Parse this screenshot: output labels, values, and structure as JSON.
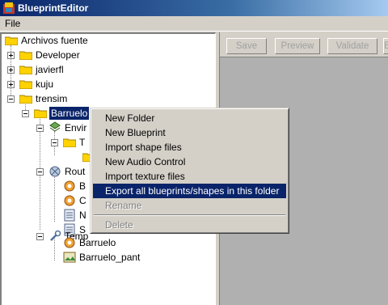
{
  "window": {
    "title": "BlueprintEditor"
  },
  "menu": {
    "file": "File"
  },
  "toolbar": {
    "save": "Save",
    "preview": "Preview",
    "validate": "Validate",
    "extra": "E"
  },
  "tree": {
    "root": "Archivos fuente",
    "developer": "Developer",
    "javierfl": "javierfl",
    "kuju": "kuju",
    "trensim": "trensim",
    "barruelo": "Barruelo",
    "envir": "Envir",
    "t_folder": "T",
    "routes": "Rout",
    "r1": "B",
    "r2": "C",
    "r3": "N",
    "r4": "S",
    "templates": "Temp",
    "barruelo_file": "Barruelo",
    "barruelo_pant": "Barruelo_pant"
  },
  "context_menu": {
    "new_folder": "New Folder",
    "new_blueprint": "New Blueprint",
    "import_shape": "Import shape files",
    "new_audio": "New Audio Control",
    "import_texture": "Import texture files",
    "export_all": "Export all blueprints/shapes in this folder",
    "rename": "Rename",
    "delete": "Delete"
  },
  "colors": {
    "folder": "#ffd200",
    "highlight": "#0a246a",
    "titlebar": "#0a246a"
  }
}
